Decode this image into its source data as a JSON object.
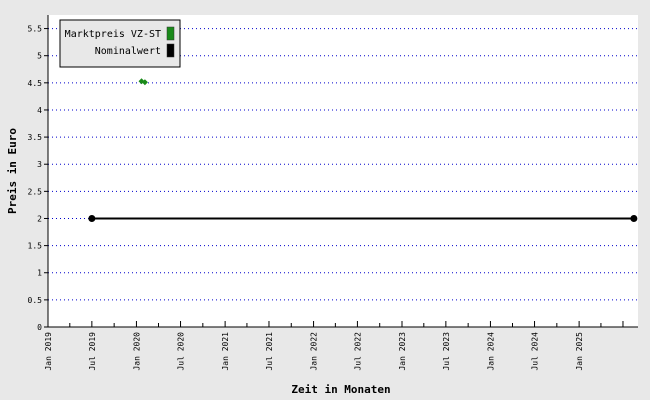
{
  "chart_data": {
    "type": "line",
    "xlabel": "Zeit in Monaten",
    "ylabel": "Preis in Euro",
    "ylim": [
      0,
      5.75
    ],
    "yticks": [
      0,
      0.5,
      1,
      1.5,
      2,
      2.5,
      3,
      3.5,
      4,
      4.5,
      5,
      5.5
    ],
    "ytick_labels": [
      "0",
      "0.5",
      "1",
      "1.5",
      "2",
      "2.5",
      "3",
      "3.5",
      "4",
      "4.5",
      "5",
      "5.5"
    ],
    "xlim": [
      "2019-01",
      "2025-09"
    ],
    "xticks": [
      "2019-01",
      "2019-07",
      "2020-01",
      "2020-07",
      "2021-01",
      "2021-07",
      "2022-01",
      "2022-07",
      "2023-01",
      "2023-07",
      "2024-01",
      "2024-07",
      "2025-01"
    ],
    "xtick_labels": [
      "Jan 2019",
      "Jul 2019",
      "Jan 2020",
      "Jul 2020",
      "Jan 2021",
      "Jul 2021",
      "Jan 2022",
      "Jul 2022",
      "Jan 2023",
      "Jul 2023",
      "Jan 2024",
      "Jul 2024",
      "Jan 2025"
    ],
    "grid": "horizontal dotted",
    "legend_position": "top-left",
    "series": [
      {
        "name": "Marktpreis VZ-ST",
        "color": "#1a8a1a",
        "style": "markers",
        "points": [
          {
            "x": "2020-01-22",
            "y": 4.53
          },
          {
            "x": "2020-02-05",
            "y": 4.51
          }
        ]
      },
      {
        "name": "Nominalwert",
        "color": "#000000",
        "style": "line",
        "points": [
          {
            "x": "2019-07-01",
            "y": 2.0
          },
          {
            "x": "2025-08-15",
            "y": 2.0
          }
        ]
      }
    ]
  }
}
